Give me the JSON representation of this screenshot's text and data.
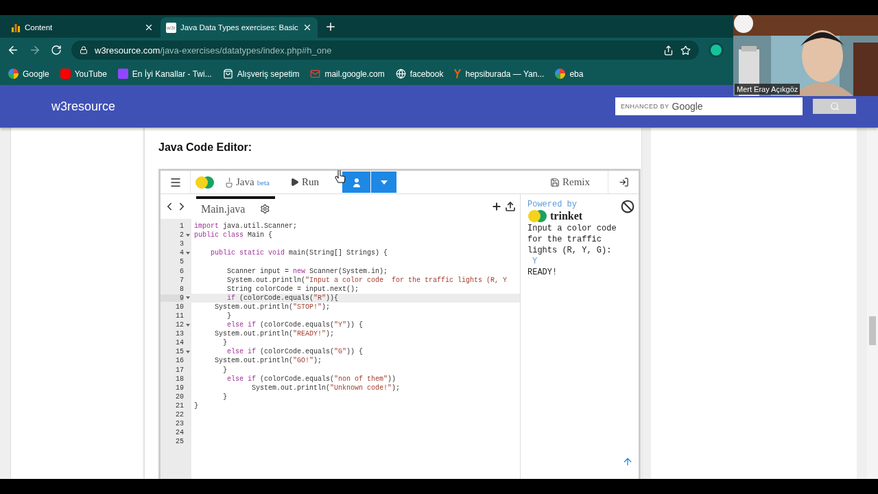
{
  "browser": {
    "tabs": [
      {
        "title": "Content",
        "selected": false
      },
      {
        "title": "Java Data Types exercises: Basic",
        "favicon": "w3r",
        "selected": true
      }
    ],
    "url": {
      "host": "w3resource.com",
      "path": "/java-exercises/datatypes/index.php#h_one"
    },
    "bookmarks": [
      {
        "label": "Google",
        "kind": "g"
      },
      {
        "label": "YouTube",
        "kind": "video"
      },
      {
        "label": "En İyi Kanallar - Twi...",
        "kind": "stream"
      },
      {
        "label": "Alışveriş sepetim",
        "kind": "bag"
      },
      {
        "label": "mail.google.com",
        "kind": "mail"
      },
      {
        "label": "facebook",
        "kind": "globe"
      },
      {
        "label": "hepsiburada — Yan...",
        "kind": "letter"
      },
      {
        "label": "eba",
        "kind": "g"
      }
    ]
  },
  "site": {
    "brand": "w3resource",
    "search": {
      "prefix": "ENHANCED BY",
      "brand": "Google"
    }
  },
  "section": {
    "heading": "Java Code Editor:"
  },
  "editor": {
    "language": "Java",
    "language_badge": "beta",
    "run": "Run",
    "remix": "Remix",
    "files": [
      {
        "name": "Main.java",
        "selected": true
      }
    ],
    "lines": [
      {
        "number": "1",
        "foldable": false,
        "active": false,
        "tokens": [
          {
            "kind": "keyword",
            "text": "import"
          },
          {
            "kind": "plain",
            "text": " java.util.Scanner;"
          }
        ]
      },
      {
        "number": "2",
        "foldable": true,
        "active": false,
        "tokens": [
          {
            "kind": "keyword",
            "text": "public class"
          },
          {
            "kind": "plain",
            "text": " Main {"
          }
        ]
      },
      {
        "number": "3",
        "foldable": false,
        "active": false
      },
      {
        "number": "4",
        "foldable": true,
        "active": false,
        "tokens": [
          {
            "kind": "keyword",
            "text": "    public static void"
          },
          {
            "kind": "plain",
            "text": " main(String[] Strings) {"
          }
        ]
      },
      {
        "number": "5",
        "foldable": false,
        "active": false
      },
      {
        "number": "6",
        "foldable": false,
        "active": false,
        "tokens": [
          {
            "kind": "plain",
            "text": "        Scanner input = "
          },
          {
            "kind": "keyword",
            "text": "new"
          },
          {
            "kind": "plain",
            "text": " Scanner(System.in);"
          }
        ]
      },
      {
        "number": "7",
        "foldable": false,
        "active": false,
        "tokens": [
          {
            "kind": "plain",
            "text": "        System.out.println("
          },
          {
            "kind": "string",
            "text": "\"Input a color code  for the traffic lights (R, Y"
          }
        ]
      },
      {
        "number": "8",
        "foldable": false,
        "active": false,
        "tokens": [
          {
            "kind": "plain",
            "text": "        String colorCode = input.next();"
          }
        ]
      },
      {
        "number": "9",
        "foldable": true,
        "active": true,
        "tokens": [
          {
            "kind": "keyword",
            "text": "        if"
          },
          {
            "kind": "plain",
            "text": " (colorCode.equals("
          },
          {
            "kind": "string",
            "text": "\"R\""
          },
          {
            "kind": "plain",
            "text": ")){"
          }
        ]
      },
      {
        "number": "10",
        "foldable": false,
        "active": false,
        "tokens": [
          {
            "kind": "plain",
            "text": "     System.out.println("
          },
          {
            "kind": "string",
            "text": "\"STOP!\""
          },
          {
            "kind": "plain",
            "text": ");"
          }
        ]
      },
      {
        "number": "11",
        "foldable": false,
        "active": false,
        "tokens": [
          {
            "kind": "plain",
            "text": "        }"
          }
        ]
      },
      {
        "number": "12",
        "foldable": true,
        "active": false,
        "tokens": [
          {
            "kind": "keyword",
            "text": "        else if"
          },
          {
            "kind": "plain",
            "text": " (colorCode.equals("
          },
          {
            "kind": "string",
            "text": "\"Y\""
          },
          {
            "kind": "plain",
            "text": ")) {"
          }
        ]
      },
      {
        "number": "13",
        "foldable": false,
        "active": false,
        "tokens": [
          {
            "kind": "plain",
            "text": "     System.out.println("
          },
          {
            "kind": "string",
            "text": "\"READY!\""
          },
          {
            "kind": "plain",
            "text": ");"
          }
        ]
      },
      {
        "number": "14",
        "foldable": false,
        "active": false,
        "tokens": [
          {
            "kind": "plain",
            "text": "       }"
          }
        ]
      },
      {
        "number": "15",
        "foldable": true,
        "active": false,
        "tokens": [
          {
            "kind": "keyword",
            "text": "        else if"
          },
          {
            "kind": "plain",
            "text": " (colorCode.equals("
          },
          {
            "kind": "string",
            "text": "\"G\""
          },
          {
            "kind": "plain",
            "text": ")) {"
          }
        ]
      },
      {
        "number": "16",
        "foldable": false,
        "active": false,
        "tokens": [
          {
            "kind": "plain",
            "text": "     System.out.println("
          },
          {
            "kind": "string",
            "text": "\"GO!\""
          },
          {
            "kind": "plain",
            "text": ");"
          }
        ]
      },
      {
        "number": "17",
        "foldable": false,
        "active": false,
        "tokens": [
          {
            "kind": "plain",
            "text": "       }"
          }
        ]
      },
      {
        "number": "18",
        "foldable": false,
        "active": false,
        "tokens": [
          {
            "kind": "keyword",
            "text": "        else if"
          },
          {
            "kind": "plain",
            "text": " (colorCode.equals("
          },
          {
            "kind": "string",
            "text": "\"non of them\""
          },
          {
            "kind": "plain",
            "text": "))"
          }
        ]
      },
      {
        "number": "19",
        "foldable": false,
        "active": false,
        "tokens": [
          {
            "kind": "plain",
            "text": "              System.out.println("
          },
          {
            "kind": "string",
            "text": "\"Unknown code!\""
          },
          {
            "kind": "plain",
            "text": ");"
          }
        ]
      },
      {
        "number": "20",
        "foldable": false,
        "active": false,
        "tokens": [
          {
            "kind": "plain",
            "text": "       }"
          }
        ]
      },
      {
        "number": "21",
        "foldable": false,
        "active": false,
        "tokens": [
          {
            "kind": "plain",
            "text": "}"
          }
        ]
      },
      {
        "number": "22",
        "foldable": false,
        "active": false
      },
      {
        "number": "23",
        "foldable": false,
        "active": false
      },
      {
        "number": "24",
        "foldable": false,
        "active": false
      },
      {
        "number": "25",
        "foldable": false,
        "active": false
      }
    ],
    "output": {
      "powered_by": "Powered by",
      "brand": "trinket",
      "lines": [
        {
          "kind": "prompt",
          "text": "Input a color code for the traffic lights (R, Y, G):"
        },
        {
          "kind": "input",
          "text": "Y"
        },
        {
          "kind": "prompt",
          "text": "READY!"
        }
      ]
    }
  },
  "webcam": {
    "name": "Mert Eray Açıkgöz"
  }
}
